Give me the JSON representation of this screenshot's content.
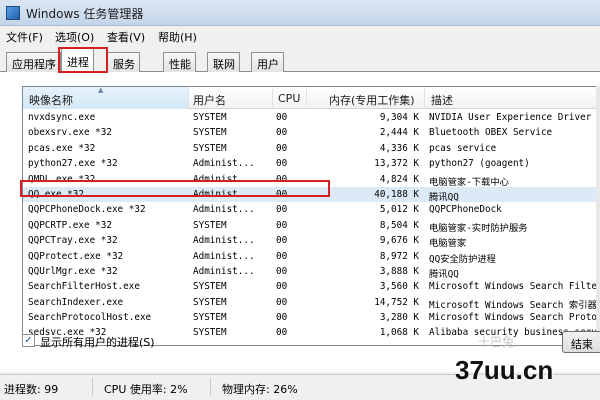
{
  "window": {
    "title": "Windows 任务管理器"
  },
  "menu": [
    "文件(F)",
    "选项(O)",
    "查看(V)",
    "帮助(H)"
  ],
  "tabs": [
    "应用程序",
    "进程",
    "服务",
    "性能",
    "联网",
    "用户"
  ],
  "active_tab": "进程",
  "columns": {
    "name": "映像名称",
    "user": "用户名",
    "cpu": "CPU",
    "mem": "内存(专用工作集)",
    "desc": "描述"
  },
  "processes": [
    {
      "name": "nvxdsync.exe",
      "user": "SYSTEM",
      "cpu": "00",
      "mem": "9,304 K",
      "desc": "NVIDIA User Experience Driver C"
    },
    {
      "name": "obexsrv.exe *32",
      "user": "SYSTEM",
      "cpu": "00",
      "mem": "2,444 K",
      "desc": "Bluetooth OBEX Service"
    },
    {
      "name": "pcas.exe *32",
      "user": "SYSTEM",
      "cpu": "00",
      "mem": "4,336 K",
      "desc": "pcas service"
    },
    {
      "name": "python27.exe *32",
      "user": "Administ...",
      "cpu": "00",
      "mem": "13,372 K",
      "desc": "python27 (goagent)"
    },
    {
      "name": "QMDL.exe *32",
      "user": "Administ...",
      "cpu": "00",
      "mem": "4,824 K",
      "desc": "电脑管家-下载中心"
    },
    {
      "name": "QQ.exe *32",
      "user": "Administ...",
      "cpu": "00",
      "mem": "40,188 K",
      "desc": "腾讯QQ"
    },
    {
      "name": "QQPCPhoneDock.exe *32",
      "user": "Administ...",
      "cpu": "00",
      "mem": "5,012 K",
      "desc": "QQPCPhoneDock"
    },
    {
      "name": "QQPCRTP.exe *32",
      "user": "SYSTEM",
      "cpu": "00",
      "mem": "8,504 K",
      "desc": "电脑管家-实时防护服务"
    },
    {
      "name": "QQPCTray.exe *32",
      "user": "Administ...",
      "cpu": "00",
      "mem": "9,676 K",
      "desc": "电脑管家"
    },
    {
      "name": "QQProtect.exe *32",
      "user": "Administ...",
      "cpu": "00",
      "mem": "8,972 K",
      "desc": "QQ安全防护进程"
    },
    {
      "name": "QQUrlMgr.exe *32",
      "user": "Administ...",
      "cpu": "00",
      "mem": "3,888 K",
      "desc": "腾讯QQ"
    },
    {
      "name": "SearchFilterHost.exe",
      "user": "SYSTEM",
      "cpu": "00",
      "mem": "3,560 K",
      "desc": "Microsoft Windows Search Filter"
    },
    {
      "name": "SearchIndexer.exe",
      "user": "SYSTEM",
      "cpu": "00",
      "mem": "14,752 K",
      "desc": "Microsoft Windows Search 索引器"
    },
    {
      "name": "SearchProtocolHost.exe",
      "user": "SYSTEM",
      "cpu": "00",
      "mem": "3,280 K",
      "desc": "Microsoft Windows Search Protoc"
    },
    {
      "name": "sedsvc.exe *32",
      "user": "SYSTEM",
      "cpu": "00",
      "mem": "1,068 K",
      "desc": "Alibaba security business servi"
    }
  ],
  "selected_process": "QQ.exe *32",
  "show_all_users": {
    "label": "显示所有用户的进程(S)",
    "checked": true
  },
  "end_button": "结束",
  "status": {
    "processes": "进程数: 99",
    "cpu": "CPU 使用率: 2%",
    "memory": "物理内存: 26%"
  },
  "watermark": {
    "text": "37uu.cn",
    "logo": "十巴兔"
  },
  "colors": {
    "highlight": "#d42020",
    "selected_row": "#dceaf7"
  }
}
